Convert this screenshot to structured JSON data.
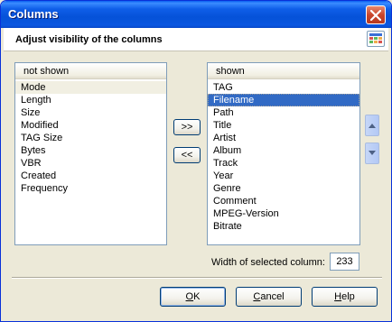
{
  "window": {
    "title": "Columns",
    "close_icon": "close-icon"
  },
  "header": {
    "text": "Adjust visibility of the columns",
    "icon": "columns-grid-icon"
  },
  "not_shown": {
    "header": "not shown",
    "items": [
      "Mode",
      "Length",
      "Size",
      "Modified",
      "TAG Size",
      "Bytes",
      "VBR",
      "Created",
      "Frequency"
    ]
  },
  "shown": {
    "header": "shown",
    "items": [
      "TAG",
      "Filename",
      "Path",
      "Title",
      "Artist",
      "Album",
      "Track",
      "Year",
      "Genre",
      "Comment",
      "MPEG-Version",
      "Bitrate"
    ],
    "selected_item": "Filename"
  },
  "move": {
    "add_label": ">>",
    "remove_label": "<<",
    "up_icon": "arrow-up-icon",
    "down_icon": "arrow-down-icon"
  },
  "width": {
    "label": "Width of selected column:",
    "value": "233"
  },
  "buttons": {
    "ok": "OK",
    "cancel": "Cancel",
    "help": "Help"
  },
  "colors": {
    "title_bar": "#0552d8",
    "selection": "#316ac5",
    "dialog_bg": "#ece9d8"
  }
}
